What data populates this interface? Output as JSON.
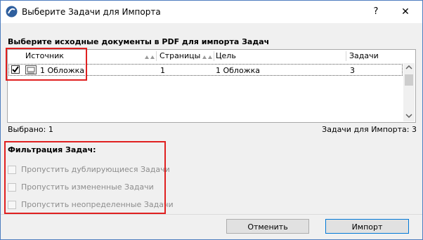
{
  "window": {
    "title": "Выберите Задачи для Импорта",
    "help_glyph": "?",
    "close_glyph": "✕"
  },
  "source_section": {
    "label": "Выберите исходные документы в PDF для импорта Задач",
    "columns": [
      "Источник",
      "Страницы",
      "Цель",
      "Задачи"
    ],
    "rows": [
      {
        "checked": true,
        "source": "1 Обложка",
        "pages": "1",
        "target": "1 Обложка",
        "tasks": "3"
      }
    ]
  },
  "summary": {
    "selected": "Выбрано: 1",
    "tasks_to_import": "Задачи для Импорта: 3"
  },
  "filter": {
    "label": "Фильтрация Задач:",
    "options": [
      {
        "label": "Пропустить дублирующиеся Задачи",
        "checked": false,
        "enabled": false
      },
      {
        "label": "Пропустить измененные Задачи",
        "checked": false,
        "enabled": false
      },
      {
        "label": "Пропустить неопределенные Задачи",
        "checked": false,
        "enabled": false
      }
    ]
  },
  "buttons": {
    "cancel": "Отменить",
    "import": "Импорт"
  },
  "colors": {
    "highlight_box": "#e02020",
    "window_border": "#4f7ebf",
    "default_button_border": "#0078d7"
  }
}
